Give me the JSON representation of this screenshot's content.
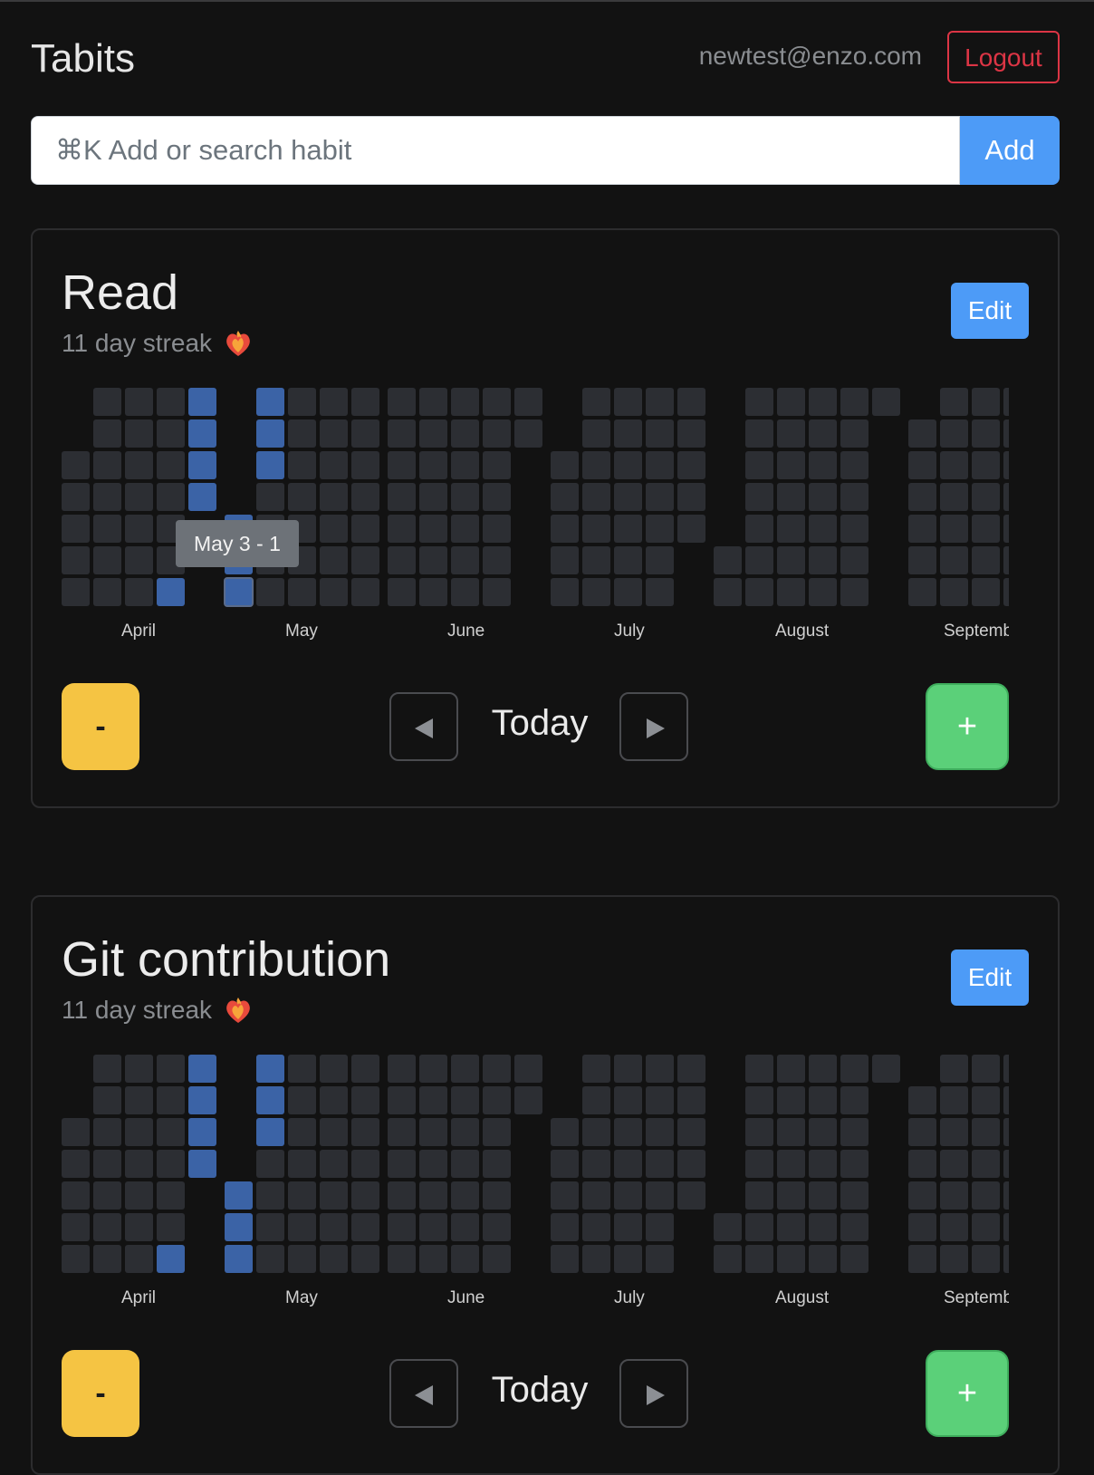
{
  "app": {
    "title": "Tabits",
    "user_email": "newtest@enzo.com",
    "logout_label": "Logout"
  },
  "search": {
    "placeholder": "⌘K Add or search habit",
    "add_label": "Add"
  },
  "colors": {
    "background": "#121212",
    "accent_blue": "#4d9bf7",
    "heat_on": "#3b63a6",
    "heat_off": "#2c2e33",
    "minus_yellow": "#f5c443",
    "plus_green": "#5bd079",
    "logout_red": "#dc3545"
  },
  "habits": [
    {
      "title": "Read",
      "streak": "11 day streak",
      "edit_label": "Edit",
      "minus_label": "-",
      "plus_label": "+",
      "date_label": "Today",
      "tooltip": "May 3 - 1",
      "months": [
        "April",
        "May",
        "June",
        "July",
        "August",
        "Septemb"
      ],
      "icons": [
        "fire-heart-icon",
        "arrow-left-icon",
        "arrow-right-icon"
      ]
    },
    {
      "title": "Git contribution",
      "streak": "11 day streak",
      "edit_label": "Edit",
      "minus_label": "-",
      "plus_label": "+",
      "date_label": "Today",
      "tooltip": "",
      "months": [
        "April",
        "May",
        "June",
        "July",
        "August",
        "Septemb"
      ],
      "icons": [
        "fire-heart-icon",
        "arrow-left-icon",
        "arrow-right-icon"
      ]
    }
  ]
}
